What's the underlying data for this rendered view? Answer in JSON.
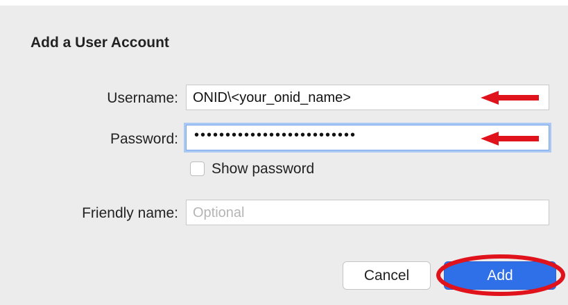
{
  "dialog": {
    "title": "Add a User Account",
    "username": {
      "label": "Username:",
      "value": "ONID\\<your_onid_name>"
    },
    "password": {
      "label": "Password:",
      "masked_value": "••••••••••••••••••••••••••"
    },
    "show_password": {
      "label": "Show password",
      "checked": false
    },
    "friendly_name": {
      "label": "Friendly name:",
      "placeholder": "Optional",
      "value": ""
    },
    "buttons": {
      "cancel": "Cancel",
      "add": "Add"
    }
  },
  "annotations": {
    "arrow_color": "#e0121b",
    "highlight_color": "#e0121b"
  },
  "colors": {
    "accent": "#2f6fe8",
    "focus_ring": "#a9c8f3",
    "background": "#ececec"
  }
}
